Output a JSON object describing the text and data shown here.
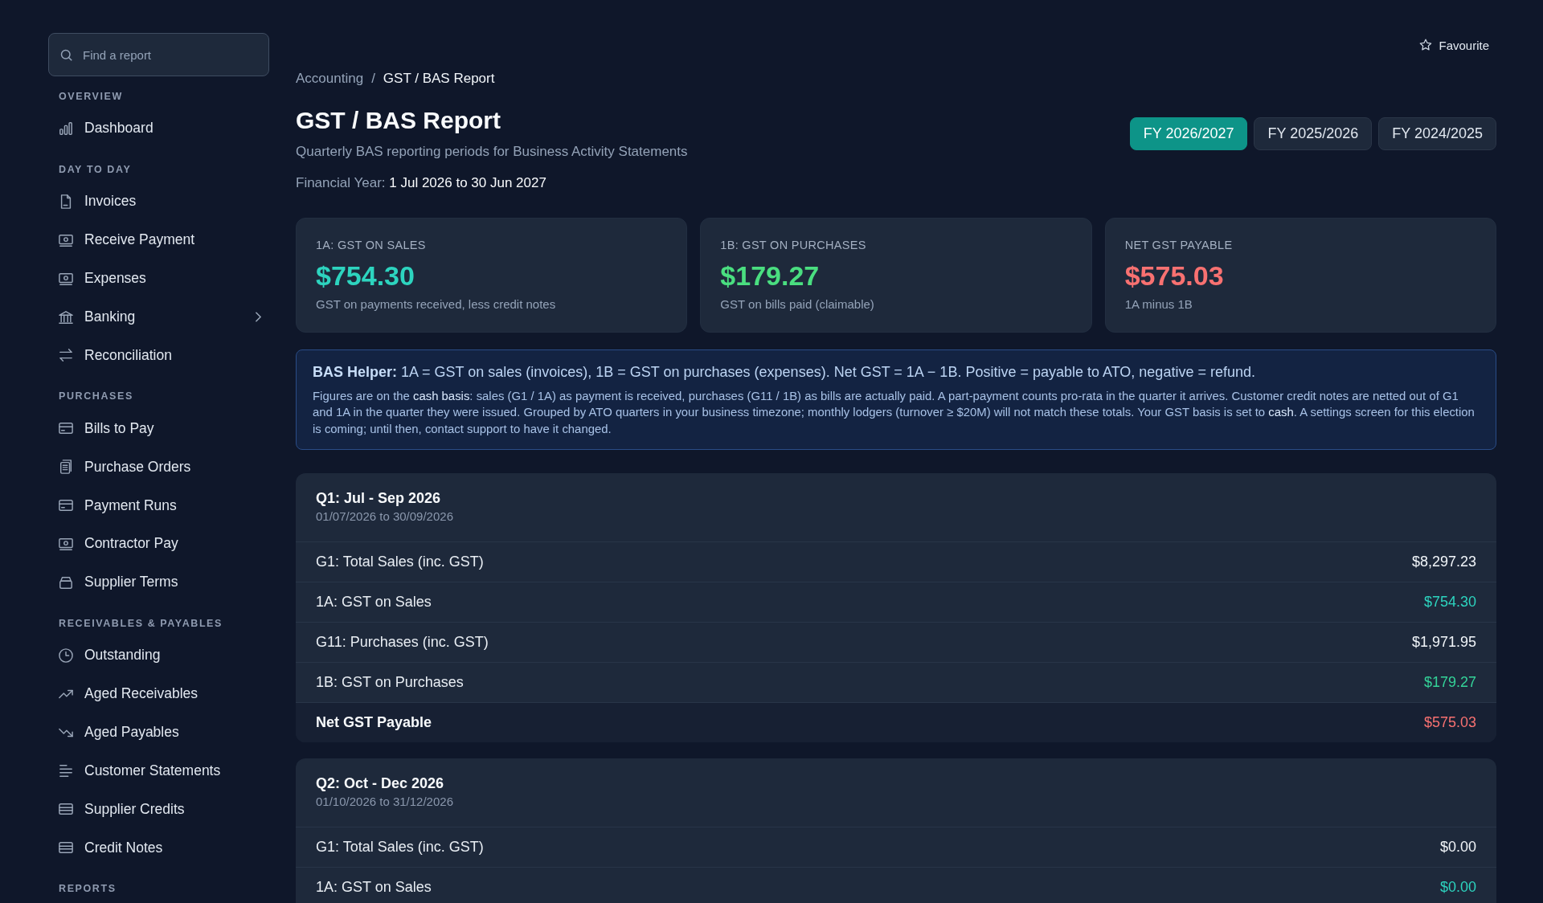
{
  "sidebar": {
    "search": {
      "placeholder": "Find a report"
    },
    "sections": [
      {
        "title": "OVERVIEW",
        "items": [
          {
            "label": "Dashboard",
            "kind": "link",
            "selected": false
          }
        ]
      },
      {
        "title": "DAY TO DAY",
        "items": [
          {
            "label": "Invoices",
            "kind": "link",
            "selected": false
          },
          {
            "label": "Receive Payment",
            "kind": "link",
            "selected": false
          },
          {
            "label": "Expenses",
            "kind": "link",
            "selected": false
          },
          {
            "label": "Banking",
            "kind": "group",
            "selected": false
          },
          {
            "label": "Reconciliation",
            "kind": "link",
            "selected": false
          }
        ]
      },
      {
        "title": "PURCHASES",
        "items": [
          {
            "label": "Bills to Pay",
            "kind": "link",
            "selected": false
          },
          {
            "label": "Purchase Orders",
            "kind": "link",
            "selected": false
          },
          {
            "label": "Payment Runs",
            "kind": "link",
            "selected": false
          },
          {
            "label": "Contractor Pay",
            "kind": "link",
            "selected": false
          },
          {
            "label": "Supplier Terms",
            "kind": "link",
            "selected": false
          }
        ]
      },
      {
        "title": "RECEIVABLES & PAYABLES",
        "items": [
          {
            "label": "Outstanding",
            "kind": "link",
            "selected": false
          },
          {
            "label": "Aged Receivables",
            "kind": "link",
            "selected": false
          },
          {
            "label": "Aged Payables",
            "kind": "link",
            "selected": false
          },
          {
            "label": "Customer Statements",
            "kind": "link",
            "selected": false
          },
          {
            "label": "Supplier Credits",
            "kind": "link",
            "selected": false
          },
          {
            "label": "Credit Notes",
            "kind": "link",
            "selected": false
          }
        ]
      },
      {
        "title": "REPORTS"
      }
    ]
  },
  "header": {
    "favourite": {
      "label": "Favourite",
      "on": false
    },
    "breadcrumb": {
      "items": [
        "Accounting",
        "GST / BAS Report"
      ],
      "separator": "/"
    },
    "title": "GST / BAS Report",
    "subtitle": "Quarterly BAS reporting periods for Business Activity Statements",
    "financial_year": {
      "label": "Financial Year:",
      "value": "1 Jul 2026 to 30 Jun 2027"
    },
    "years": [
      {
        "label": "FY 2026/2027",
        "selected": true
      },
      {
        "label": "FY 2025/2026",
        "selected": false
      },
      {
        "label": "FY 2024/2025",
        "selected": false
      }
    ]
  },
  "stats": [
    {
      "label": "1A: GST ON SALES",
      "value": "$754.30",
      "note": "GST on payments received, less credit notes",
      "color": "#2dd4bf"
    },
    {
      "label": "1B: GST ON PURCHASES",
      "value": "$179.27",
      "note": "GST on bills paid (claimable)",
      "color": "#4ade80"
    },
    {
      "label": "NET GST PAYABLE",
      "value": "$575.03",
      "note": "1A minus 1B",
      "color": "#f87171"
    }
  ],
  "helper": {
    "summary": "**BAS Helper:** 1A = GST on sales (invoices), 1B = GST on purchases (expenses). Net GST = 1A − 1B. Positive = payable to ATO, negative = refund.",
    "details": "Figures are on the **cash basis**: sales (G1 / 1A) as payment is received, purchases (G11 / 1B) as bills are actually paid. A part-payment counts pro-rata in the quarter it arrives. Customer credit notes are netted out of G1 and 1A in the quarter they were issued. Grouped by ATO quarters in your business timezone; monthly lodgers (turnover ≥ $20M) will not match these totals. Your GST basis is set to **cash**. A settings screen for this election is coming; until then, contact support to have it changed."
  },
  "quarters": [
    {
      "title": "Q1: Jul - Sep 2026",
      "dates": "01/07/2026 to 30/09/2026",
      "rows": [
        {
          "label": "G1: Total Sales (inc. GST)",
          "amount": "$8,297.23",
          "kind": "line",
          "color": "#f1f5f9"
        },
        {
          "label": "1A: GST on Sales",
          "amount": "$754.30",
          "kind": "line",
          "color": "#2dd4bf"
        },
        {
          "label": "G11: Purchases (inc. GST)",
          "amount": "$1,971.95",
          "kind": "line",
          "color": "#f1f5f9"
        },
        {
          "label": "1B: GST on Purchases",
          "amount": "$179.27",
          "kind": "line",
          "color": "#34d399"
        },
        {
          "label": "Net GST Payable",
          "amount": "$575.03",
          "kind": "total",
          "color": "#f87171"
        }
      ]
    },
    {
      "title": "Q2: Oct - Dec 2026",
      "dates": "01/10/2026 to 31/12/2026",
      "rows": [
        {
          "label": "G1: Total Sales (inc. GST)",
          "amount": "$0.00",
          "kind": "line",
          "color": "#f1f5f9"
        },
        {
          "label": "1A: GST on Sales",
          "amount": "$0.00",
          "kind": "line",
          "color": "#2dd4bf"
        }
      ]
    }
  ]
}
